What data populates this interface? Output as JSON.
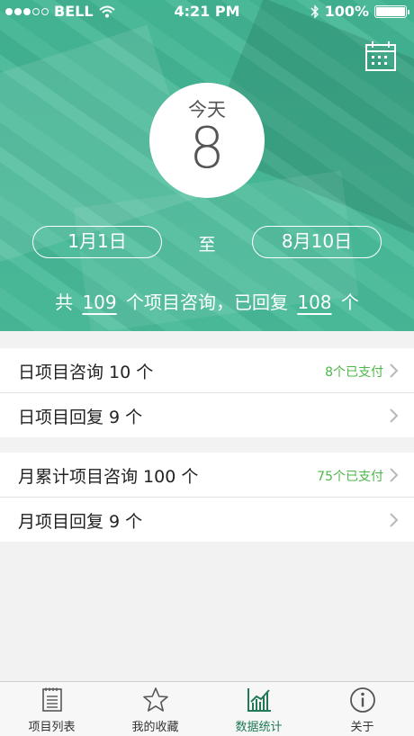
{
  "status_bar": {
    "carrier": "BELL",
    "time": "4:21 PM",
    "battery": "100%"
  },
  "header": {
    "today_label": "今天",
    "today_number": "8",
    "date_start": "1月1日",
    "date_separator": "至",
    "date_end": "8月10日",
    "summary": {
      "prefix": "共",
      "total": "109",
      "middle": "个项目咨询，已回复",
      "replied": "108",
      "suffix": "个"
    }
  },
  "daily": {
    "consult_title": "日项目咨询 10 个",
    "consult_badge": "8个已支付",
    "reply_title": "日项目回复 9 个"
  },
  "monthly": {
    "consult_title": "月累计项目咨询 100 个",
    "consult_badge": "75个已支付",
    "reply_title": "月项目回复 9 个"
  },
  "tabs": [
    {
      "label": "项目列表",
      "icon": "list-icon"
    },
    {
      "label": "我的收藏",
      "icon": "star-icon"
    },
    {
      "label": "数据统计",
      "icon": "chart-icon"
    },
    {
      "label": "关于",
      "icon": "info-icon"
    }
  ],
  "colors": {
    "accent": "#42b896",
    "badge_green": "#4cb748",
    "active_tab": "#1f7a55"
  }
}
